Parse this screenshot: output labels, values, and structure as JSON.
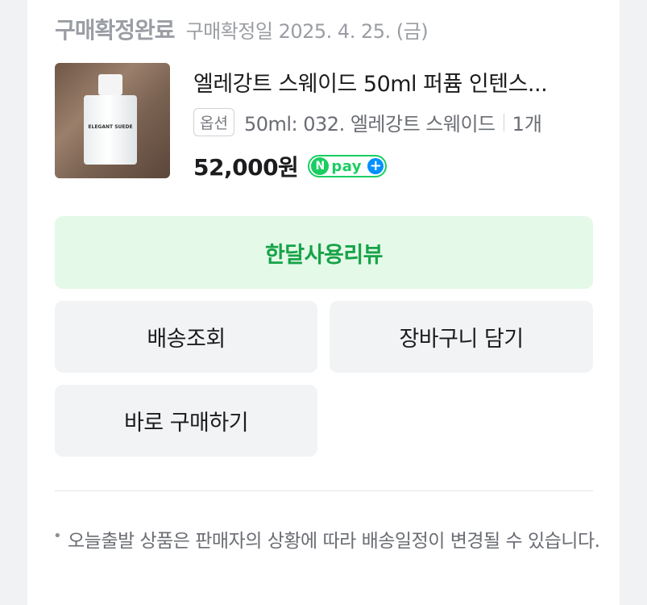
{
  "order": {
    "status": "구매확정완료",
    "date_text": "구매확정일 2025. 4. 25. (금)"
  },
  "product": {
    "name": "엘레강트 스웨이드 50ml 퍼퓸 인텐스...",
    "option_badge": "옵션",
    "option_text": "50ml: 032. 엘레강트 스웨이드",
    "quantity": "1개",
    "price": "52,000원",
    "bottle_label": "ELEGANT SUEDE"
  },
  "payment": {
    "npay_n": "N",
    "npay_text": "pay",
    "npay_plus": "+",
    "brand_color": "#19ce60",
    "plus_color": "#0090ff"
  },
  "actions": {
    "review_label": "한달사용리뷰",
    "shipping_label": "배송조회",
    "cart_label": "장바구니 담기",
    "buy_again_label": "바로 구매하기"
  },
  "notice": {
    "bullet": "•",
    "text": "오늘출발 상품은 판매자의 상황에 따라 배송일정이 변경될 수 있습니다."
  },
  "colors": {
    "review_bg": "#e4f9e8",
    "review_text": "#17a348",
    "button_gray": "#f1f3f5"
  }
}
